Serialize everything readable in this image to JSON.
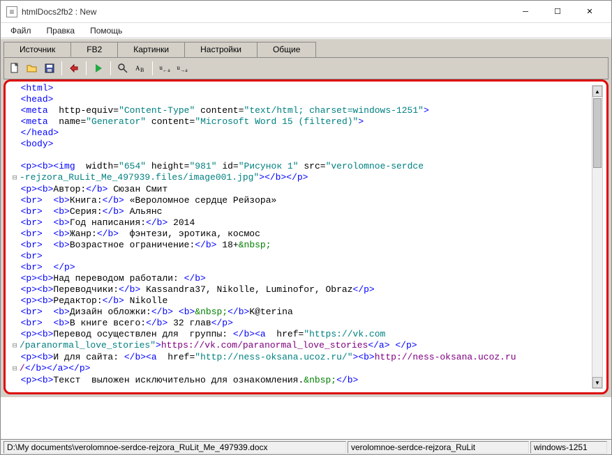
{
  "window": {
    "title": "htmlDocs2fb2 : New"
  },
  "menu": {
    "file": "Файл",
    "edit": "Правка",
    "help": "Помощь"
  },
  "tabs": {
    "source": "Источник",
    "fb2": "FB2",
    "pictures": "Картинки",
    "settings": "Настройки",
    "common": "Общие"
  },
  "toolbar": {
    "new": "new-file",
    "open": "open-file",
    "save": "save-file",
    "convert": "convert",
    "run": "run",
    "find": "find",
    "replace": "replace",
    "ua1": "ua-left",
    "ua2": "ua-right"
  },
  "status": {
    "path": "D:\\My documents\\verolomnoe-serdce-rejzora_RuLit_Me_497939.docx",
    "doc": "verolomnoe-serdce-rejzora_RuLit",
    "encoding": "windows-1251"
  }
}
